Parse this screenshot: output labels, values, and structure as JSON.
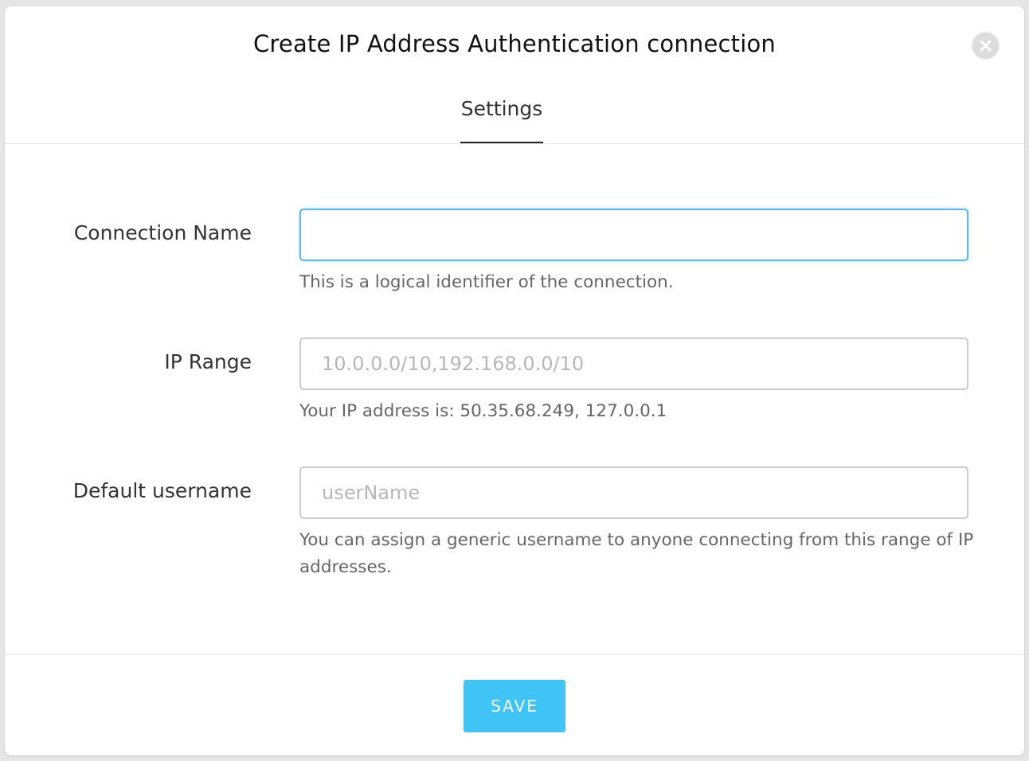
{
  "modal": {
    "title": "Create IP Address Authentication connection",
    "close_icon": "close-icon"
  },
  "tabs": [
    {
      "label": "Settings",
      "active": true
    }
  ],
  "fields": {
    "connection_name": {
      "label": "Connection Name",
      "value": "",
      "placeholder": "",
      "help": "This is a logical identifier of the connection."
    },
    "ip_range": {
      "label": "IP Range",
      "value": "",
      "placeholder": "10.0.0.0/10,192.168.0.0/10",
      "help": "Your IP address is: 50.35.68.249, 127.0.0.1"
    },
    "default_username": {
      "label": "Default username",
      "value": "",
      "placeholder": "userName",
      "help": "You can assign a generic username to anyone connecting from this range of IP addresses."
    }
  },
  "footer": {
    "save_label": "SAVE"
  },
  "colors": {
    "accent": "#3fc4f5",
    "focus_border": "#5cb7f1"
  }
}
